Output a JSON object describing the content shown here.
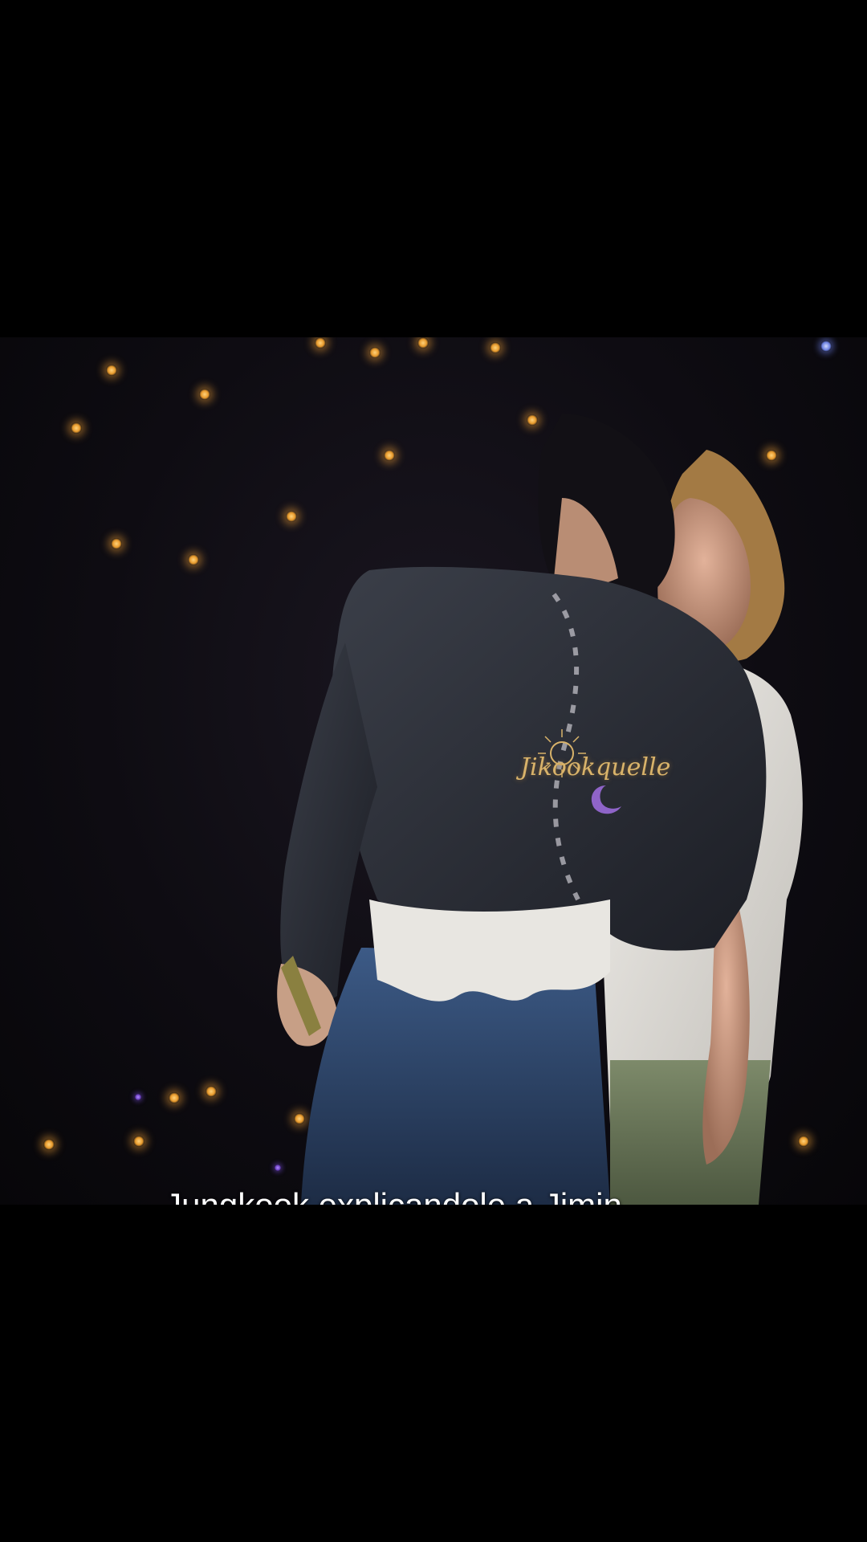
{
  "video": {
    "caption": "Jungkook explicandole a Jimin como es que funciona esta baina, y el toquesito al final 😏",
    "watermark": "Jikookquelle"
  },
  "colors": {
    "background": "#000000",
    "caption_text": "#ffffff",
    "watermark": "#d9b36a",
    "stage_light": "#e89a2c"
  }
}
